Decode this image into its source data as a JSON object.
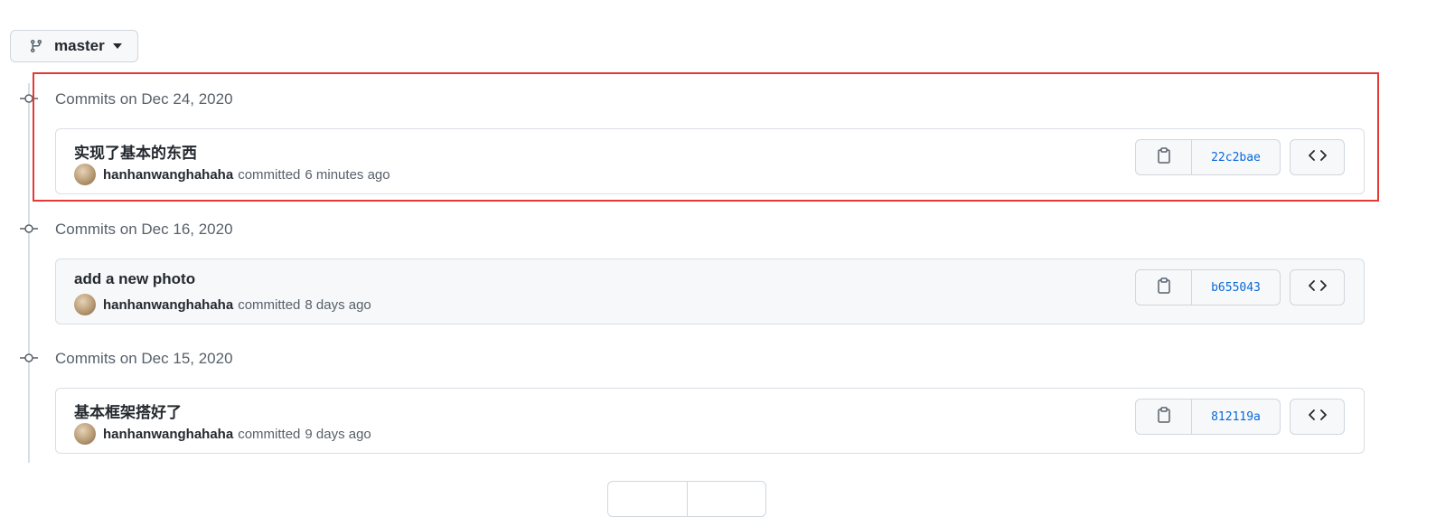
{
  "branch": {
    "name": "master"
  },
  "groups": [
    {
      "date_label": "Commits on Dec 24, 2020",
      "commit": {
        "title": "实现了基本的东西",
        "author": "hanhanwanghahaha",
        "verb": "committed",
        "time": "6 minutes ago",
        "sha": "22c2bae"
      }
    },
    {
      "date_label": "Commits on Dec 16, 2020",
      "commit": {
        "title": "add a new photo",
        "author": "hanhanwanghahaha",
        "verb": "committed",
        "time": "8 days ago",
        "sha": "b655043"
      }
    },
    {
      "date_label": "Commits on Dec 15, 2020",
      "commit": {
        "title": "基本框架搭好了",
        "author": "hanhanwanghahaha",
        "verb": "committed",
        "time": "9 days ago",
        "sha": "812119a"
      }
    }
  ],
  "colors": {
    "highlight": "#e53935",
    "sha_link": "#0969da",
    "border": "#d0d7de"
  },
  "icons": [
    "git-branch-icon",
    "caret-down-icon",
    "commit-node-icon",
    "copy-icon",
    "code-icon"
  ]
}
